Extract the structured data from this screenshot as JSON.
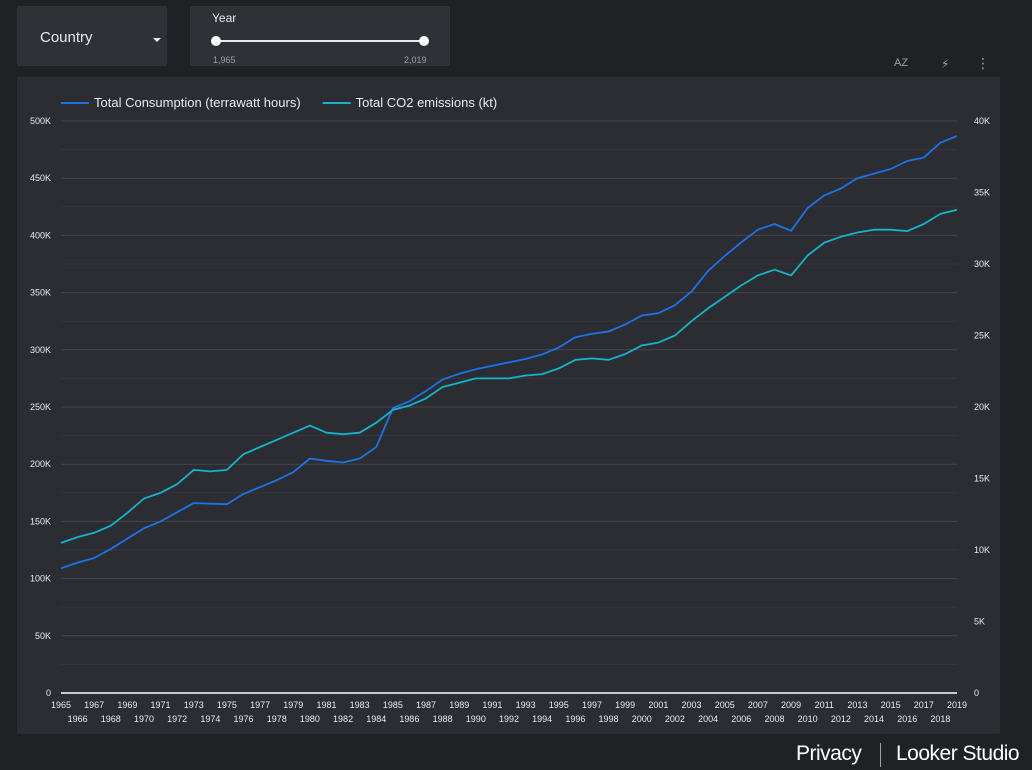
{
  "controls": {
    "country_filter": {
      "label": "Country"
    },
    "year_slider": {
      "title": "Year",
      "min_label": "1,965",
      "max_label": "2,019",
      "range": [
        1965,
        2019
      ]
    }
  },
  "toolbar": {
    "sort_icon": "sort-az-icon",
    "sort_label": "AZ",
    "bolt_icon": "bolt-icon",
    "bolt_label": "⚡",
    "more_icon": "more-vert-icon",
    "more_label": "⋮"
  },
  "footer": {
    "privacy": "Privacy",
    "brand": "Looker Studio"
  },
  "colors": {
    "series1": "#1a73e8",
    "series2": "#12b5cb",
    "card": "#2b2d33",
    "page": "#202124"
  },
  "chart_data": {
    "type": "line",
    "title": "",
    "legend_position": "top-left",
    "grid": true,
    "x": [
      1965,
      1966,
      1967,
      1968,
      1969,
      1970,
      1971,
      1972,
      1973,
      1974,
      1975,
      1976,
      1977,
      1978,
      1979,
      1980,
      1981,
      1982,
      1983,
      1984,
      1985,
      1986,
      1987,
      1988,
      1989,
      1990,
      1991,
      1992,
      1993,
      1994,
      1995,
      1996,
      1997,
      1998,
      1999,
      2000,
      2001,
      2002,
      2003,
      2004,
      2005,
      2006,
      2007,
      2008,
      2009,
      2010,
      2011,
      2012,
      2013,
      2014,
      2015,
      2016,
      2017,
      2018,
      2019
    ],
    "y_left": {
      "min": 0,
      "max": 500000,
      "ticks": [
        "0",
        "50K",
        "100K",
        "150K",
        "200K",
        "250K",
        "300K",
        "350K",
        "400K",
        "450K",
        "500K"
      ]
    },
    "y_right": {
      "min": 0,
      "max": 40000,
      "ticks": [
        "0",
        "5K",
        "10K",
        "15K",
        "20K",
        "25K",
        "30K",
        "35K",
        "40K"
      ]
    },
    "series": [
      {
        "name": "Total Consumption (terrawatt hours)",
        "axis": "left",
        "color": "#1a73e8",
        "values": [
          109000,
          114000,
          118000,
          126000,
          135000,
          144000,
          150000,
          158000,
          166000,
          165500,
          165000,
          174000,
          180000,
          186000,
          193000,
          205000,
          203000,
          201500,
          205000,
          215000,
          249000,
          255000,
          264000,
          274000,
          279000,
          283000,
          286000,
          289000,
          292000,
          296000,
          302000,
          311000,
          314000,
          316000,
          322000,
          330000,
          332000,
          339000,
          351000,
          369000,
          382000,
          394000,
          405000,
          410000,
          404000,
          424000,
          435000,
          441000,
          450000,
          454000,
          458000,
          465000,
          468000,
          481000,
          487000
        ]
      },
      {
        "name": "Total CO2 emissions (kt)",
        "axis": "right",
        "color": "#12b5cb",
        "values": [
          10500,
          10900,
          11200,
          11700,
          12600,
          13600,
          14000,
          14600,
          15600,
          15500,
          15600,
          16700,
          17200,
          17700,
          18200,
          18700,
          18200,
          18100,
          18200,
          18900,
          19800,
          20100,
          20600,
          21400,
          21700,
          22000,
          22000,
          22000,
          22200,
          22300,
          22700,
          23300,
          23400,
          23300,
          23700,
          24300,
          24500,
          25000,
          26000,
          26900,
          27700,
          28500,
          29200,
          29600,
          29200,
          30600,
          31500,
          31900,
          32200,
          32400,
          32400,
          32300,
          32800,
          33500,
          33800
        ]
      }
    ]
  }
}
